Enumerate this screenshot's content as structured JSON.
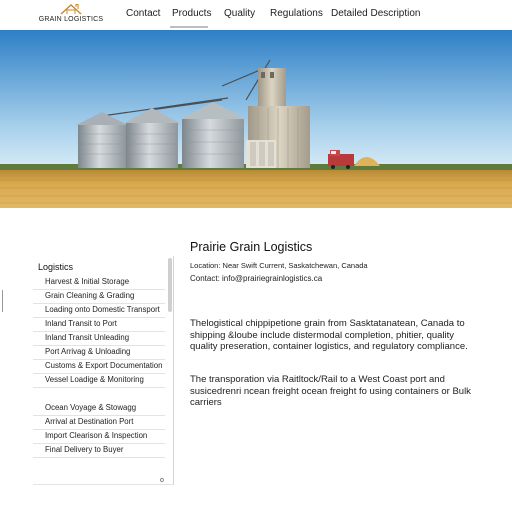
{
  "header": {
    "logo_text": "GRAIN LOGISTICS",
    "nav": [
      {
        "id": "contact",
        "label": "Contact"
      },
      {
        "id": "products",
        "label": "Products"
      },
      {
        "id": "quality",
        "label": "Quality"
      },
      {
        "id": "regulations",
        "label": "Regulations"
      },
      {
        "id": "details",
        "label": "Detailed Description"
      }
    ],
    "active_nav": "Products"
  },
  "main": {
    "title": "Prairie Grain Logistics",
    "location": "Location: Near Swift Current, Saskatchewan, Canada",
    "contact": "Contact: info@prairiegrainlogistics.ca",
    "paragraph1": "Thelogistical chippipetione grain from Sasktatanatean, Canada to shipping &loube include distermodal completion, phitier, quality quality preseration, container logistics, and regulatory compliance.",
    "paragraph2": "The transporation via Raitltock/Rail to a West Coast port and susicedrenri ncean freight ocean freight fo using containers or Bulk carriers"
  },
  "sidebar": {
    "title": "Logistics",
    "items_group1": [
      "Harvest & Initial Storage",
      "Grain Cleaning & Grading",
      "Loading onto Domestic Transport",
      "Inland Transit to Port",
      "Inland Transit Unleading",
      "Port Arrivag & Unloading",
      "Customs & Export Documentation",
      "Vessel Loadige & Monitoring"
    ],
    "items_group2": [
      "Ocean Voyage & Stowagg",
      "Arrival at Destination Port",
      "Import Clearison & Inspection",
      "Final Delivery to Buyer"
    ],
    "corner_glyph": "o"
  },
  "colors": {
    "sky_top": "#2d7fc6",
    "sky_bottom": "#cfe6f4",
    "wheat": "#d9a94e",
    "silo": "#b9c0c4",
    "concrete": "#c9c0ad",
    "truck": "#b83a3a"
  }
}
